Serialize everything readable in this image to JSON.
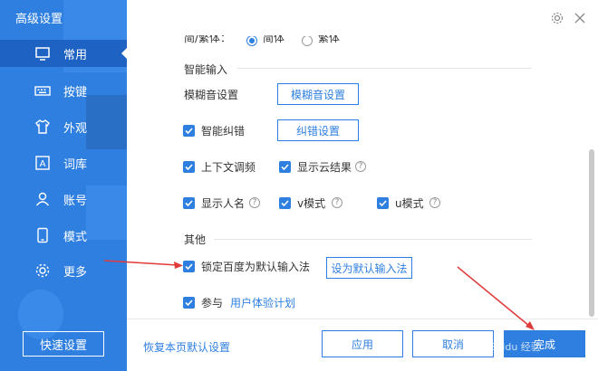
{
  "window": {
    "title": "高级设置"
  },
  "sidebar": {
    "items": [
      {
        "label": "常用",
        "icon": "monitor-icon",
        "active": true
      },
      {
        "label": "按键",
        "icon": "keyboard-icon",
        "active": false
      },
      {
        "label": "外观",
        "icon": "shirt-icon",
        "active": false
      },
      {
        "label": "词库",
        "icon": "dictionary-icon",
        "active": false
      },
      {
        "label": "账号",
        "icon": "user-icon",
        "active": false
      },
      {
        "label": "模式",
        "icon": "phone-mode-icon",
        "active": false
      },
      {
        "label": "更多",
        "icon": "gear-icon",
        "active": false
      }
    ],
    "quick_settings": "快速设置"
  },
  "partial_row": {
    "label": "简/繁体：",
    "option_a": "简体",
    "option_b": "繁体"
  },
  "smart_input": {
    "title": "智能输入",
    "fuzzy_label": "模糊音设置",
    "fuzzy_button": "模糊音设置",
    "autocorrect_label": "智能纠错",
    "autocorrect_button": "纠错设置",
    "context_label": "上下文调频",
    "cloud_label": "显示云结果",
    "names_label": "显示人名",
    "v_mode_label": "v模式",
    "u_mode_label": "u模式"
  },
  "other": {
    "title": "其他",
    "lock_default_label": "锁定百度为默认输入法",
    "set_default_button": "设为默认输入法",
    "join_label": "参与",
    "ux_plan_link": "用户体验计划"
  },
  "footer": {
    "restore_link": "恢复本页默认设置",
    "apply": "应用",
    "cancel": "取消",
    "done": "完成"
  },
  "watermark": "Baidu 经验",
  "colors": {
    "accent": "#2f7fe0",
    "arrow": "#e03a3a"
  }
}
